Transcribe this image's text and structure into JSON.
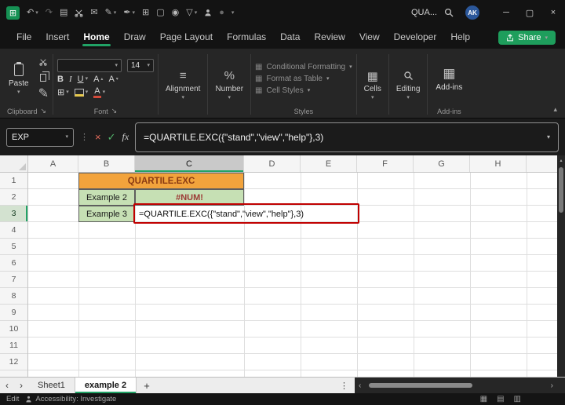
{
  "colors": {
    "accent": "#21A366",
    "title_fill": "#F2A33C",
    "title_text": "#8A3A12",
    "good_fill": "#C6E0B4",
    "error_text": "#9C3A35",
    "red_box": "#C00000"
  },
  "icons": {
    "excel_logo": "⊞",
    "caret_down": "▾",
    "undo": "↶",
    "redo": "↷",
    "book": "▤",
    "mail": "✉",
    "pen": "✎",
    "ink": "✒",
    "grid_table": "⊞",
    "shape": "▢",
    "camera": "◉",
    "filter": "▽",
    "record": "●",
    "dots_v": "⋮",
    "cancel": "×",
    "check": "✓",
    "align_lines": "≡",
    "percent": "%",
    "style_block": "▦",
    "cells_block": "▦",
    "addins_block": "▦",
    "launcher": "↘",
    "grow_caret": "▴",
    "shrink_caret": "▾",
    "borders": "⊞",
    "nav_left": "‹",
    "nav_right": "›",
    "plus": "+",
    "minimize": "─",
    "maximize": "▢",
    "close": "×",
    "ribbon_collapse": "▴",
    "scroll_up": "▴",
    "sheet_view_normal": "▦",
    "sheet_view_page": "▤",
    "sheet_view_break": "▥"
  },
  "titlebar": {
    "doc_title": "QUA...",
    "avatar_initials": "AK"
  },
  "menubar": {
    "tabs": [
      "File",
      "Insert",
      "Home",
      "Draw",
      "Page Layout",
      "Formulas",
      "Data",
      "Review",
      "View",
      "Developer",
      "Help"
    ],
    "share_label": "Share"
  },
  "ribbon": {
    "paste_label": "Paste",
    "clipboard_group": "Clipboard",
    "font_size": "14",
    "bold_label": "B",
    "italic_label": "I",
    "underline_label": "U",
    "grow_font_label": "A",
    "shrink_font_label": "A",
    "font_color_label": "A",
    "font_group": "Font",
    "alignment_label": "Alignment",
    "number_label": "Number",
    "conditional_formatting": "Conditional Formatting",
    "format_as_table": "Format as Table",
    "cell_styles": "Cell Styles",
    "styles_group": "Styles",
    "cells_label": "Cells",
    "editing_label": "Editing",
    "addins_label": "Add-ins",
    "addins_group": "Add-ins"
  },
  "formula_bar": {
    "name_box_value": "EXP",
    "fx_label": "fx",
    "formula": "=QUARTILE.EXC({\"stand\",\"view\",\"help\"},3)"
  },
  "grid": {
    "columns": [
      "A",
      "B",
      "C",
      "D",
      "E",
      "F",
      "G",
      "H"
    ],
    "rows": [
      "1",
      "2",
      "3",
      "4",
      "5",
      "6",
      "7",
      "8",
      "9",
      "10",
      "11",
      "12"
    ],
    "cells": {
      "title": "QUARTILE.EXC",
      "b2_label": "Example 2",
      "c2_value": "#NUM!",
      "b3_label": "Example 3",
      "c3_formula": "=QUARTILE.EXC({\"stand\",\"view\",\"help\"},3)"
    }
  },
  "tabbar": {
    "sheet1": "Sheet1",
    "active_sheet": "example 2"
  },
  "statusbar": {
    "mode": "Edit",
    "accessibility": "Accessibility: Investigate"
  }
}
